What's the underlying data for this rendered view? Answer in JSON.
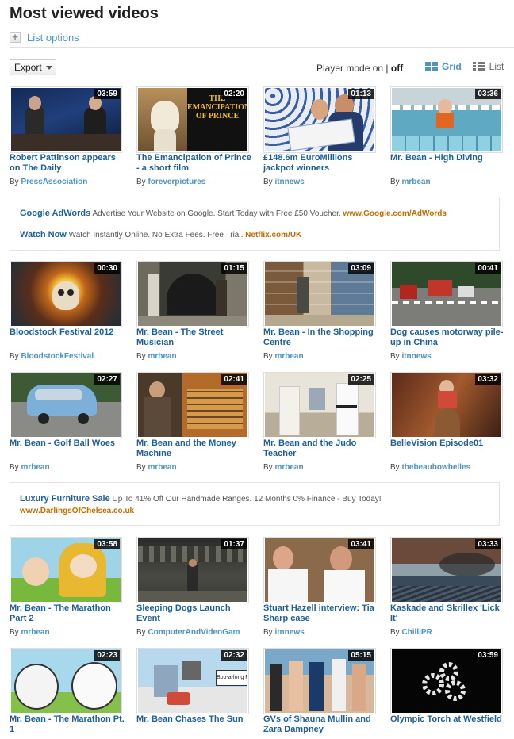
{
  "page": {
    "title": "Most viewed videos",
    "list_options_label": "List options",
    "export_label": "Export"
  },
  "player_mode": {
    "label": "Player mode",
    "on": "on",
    "separator": "|",
    "off": "off"
  },
  "view_switch": {
    "grid_label": "Grid",
    "list_label": "List",
    "active": "Grid"
  },
  "by_prefix": "By",
  "videos": [
    {
      "title": "Robert Pattinson appears on The Daily",
      "duration": "03:59",
      "author": "PressAssociation"
    },
    {
      "title": "The Emancipation of Prince - a short film",
      "duration": "02:20",
      "author": "foreverpictures",
      "thumb_text": "THE EMANCIPATION OF PRINCE"
    },
    {
      "title": "£148.6m EuroMillions jackpot winners",
      "duration": "01:13",
      "author": "itnnews"
    },
    {
      "title": "Mr. Bean - High Diving",
      "duration": "03:36",
      "author": "mrbean"
    },
    {
      "title": "Bloodstock Festival 2012",
      "duration": "00:30",
      "author": "BloodstockFestival"
    },
    {
      "title": "Mr. Bean - The Street Musician",
      "duration": "01:15",
      "author": "mrbean"
    },
    {
      "title": "Mr. Bean - In the Shopping Centre",
      "duration": "03:09",
      "author": "mrbean"
    },
    {
      "title": "Dog causes motorway pile-up in China",
      "duration": "00:41",
      "author": "itnnews"
    },
    {
      "title": "Mr. Bean - Golf Ball Woes",
      "duration": "02:27",
      "author": "mrbean"
    },
    {
      "title": "Mr. Bean and the Money Machine",
      "duration": "02:41",
      "author": "mrbean"
    },
    {
      "title": "Mr. Bean and the Judo Teacher",
      "duration": "02:25",
      "author": "mrbean"
    },
    {
      "title": "BelleVision Episode01",
      "duration": "03:32",
      "author": "thebeaubowbelles"
    },
    {
      "title": "Mr. Bean - The Marathon Part 2",
      "duration": "03:58",
      "author": "mrbean"
    },
    {
      "title": "Sleeping Dogs Launch Event",
      "duration": "01:37",
      "author": "ComputerAndVideoGam"
    },
    {
      "title": "Stuart Hazell interview: Tia Sharp case",
      "duration": "03:41",
      "author": "itnnews"
    },
    {
      "title": "Kaskade and Skrillex 'Lick It'",
      "duration": "03:33",
      "author": "ChilliPR"
    },
    {
      "title": "Mr. Bean - The Marathon Pt. 1",
      "duration": "02:23",
      "author": ""
    },
    {
      "title": "Mr. Bean Chases The Sun",
      "duration": "02:32",
      "author": "",
      "thumb_text": "Bob-a-long Fe"
    },
    {
      "title": "GVs of Shauna Mullin and Zara Dampney",
      "duration": "05:15",
      "author": ""
    },
    {
      "title": "Olympic Torch at Westfield",
      "duration": "03:59",
      "author": ""
    }
  ],
  "ads": {
    "block1": [
      {
        "headline": "Google AdWords",
        "text": "Advertise Your Website on Google. Start Today with Free £50 Voucher.",
        "url": "www.Google.com/AdWords"
      },
      {
        "headline": "Watch Now",
        "text": "Watch Instantly Online. No Extra Fees. Free Trial.",
        "url": "Netflix.com/UK"
      }
    ],
    "block2": [
      {
        "headline": "Luxury Furniture Sale",
        "text": "Up To 41% Off Our Handmade Ranges. 12 Months 0% Finance - Buy Today!",
        "url": "www.DarlingsOfChelsea.co.uk"
      }
    ]
  },
  "colors": {
    "link": "#4b95c7",
    "title_link": "#1d5f9a",
    "ad_url": "#c46d00",
    "duration_bg": "#000000"
  }
}
